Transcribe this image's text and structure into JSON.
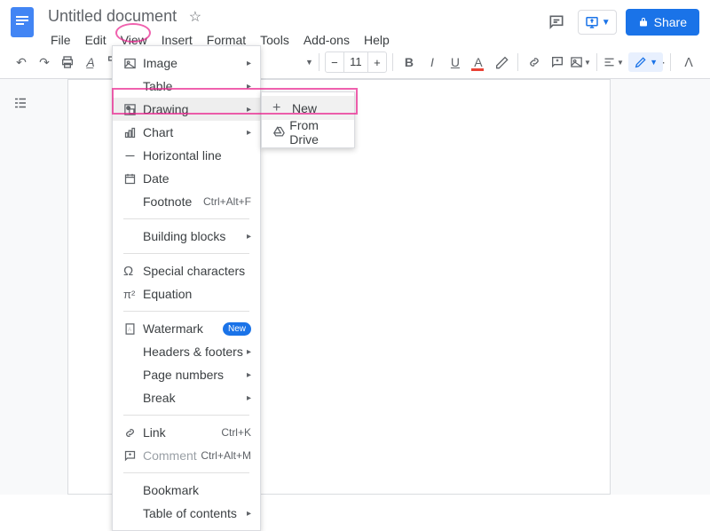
{
  "header": {
    "title": "Untitled document",
    "menus": [
      "File",
      "Edit",
      "View",
      "Insert",
      "Format",
      "Tools",
      "Add-ons",
      "Help"
    ],
    "share_label": "Share"
  },
  "toolbar": {
    "font_size": "11"
  },
  "insert_menu": {
    "items": [
      {
        "label": "Image",
        "icon": "image",
        "arrow": true
      },
      {
        "label": "Table",
        "icon": "",
        "arrow": true
      },
      {
        "label": "Drawing",
        "icon": "drawing",
        "arrow": true,
        "highlighted": true
      },
      {
        "label": "Chart",
        "icon": "chart",
        "arrow": true
      },
      {
        "label": "Horizontal line",
        "icon": "hline",
        "arrow": false
      },
      {
        "label": "Date",
        "icon": "date",
        "arrow": false
      },
      {
        "label": "Footnote",
        "icon": "",
        "shortcut": "Ctrl+Alt+F"
      },
      {
        "sep": true
      },
      {
        "label": "Building blocks",
        "icon": "",
        "arrow": true
      },
      {
        "sep": true
      },
      {
        "label": "Special characters",
        "icon": "omega",
        "arrow": false
      },
      {
        "label": "Equation",
        "icon": "pi",
        "arrow": false
      },
      {
        "sep": true
      },
      {
        "label": "Watermark",
        "icon": "watermark",
        "badge": "New"
      },
      {
        "label": "Headers & footers",
        "icon": "",
        "arrow": true
      },
      {
        "label": "Page numbers",
        "icon": "",
        "arrow": true
      },
      {
        "label": "Break",
        "icon": "",
        "arrow": true
      },
      {
        "sep": true
      },
      {
        "label": "Link",
        "icon": "link",
        "shortcut": "Ctrl+K"
      },
      {
        "label": "Comment",
        "icon": "comment",
        "shortcut": "Ctrl+Alt+M",
        "disabled": true
      },
      {
        "sep": true
      },
      {
        "label": "Bookmark",
        "icon": "",
        "arrow": false
      },
      {
        "label": "Table of contents",
        "icon": "",
        "arrow": true
      }
    ]
  },
  "drawing_submenu": {
    "items": [
      {
        "label": "New",
        "icon": "plus",
        "highlighted": true
      },
      {
        "label": "From Drive",
        "icon": "drive"
      }
    ]
  }
}
